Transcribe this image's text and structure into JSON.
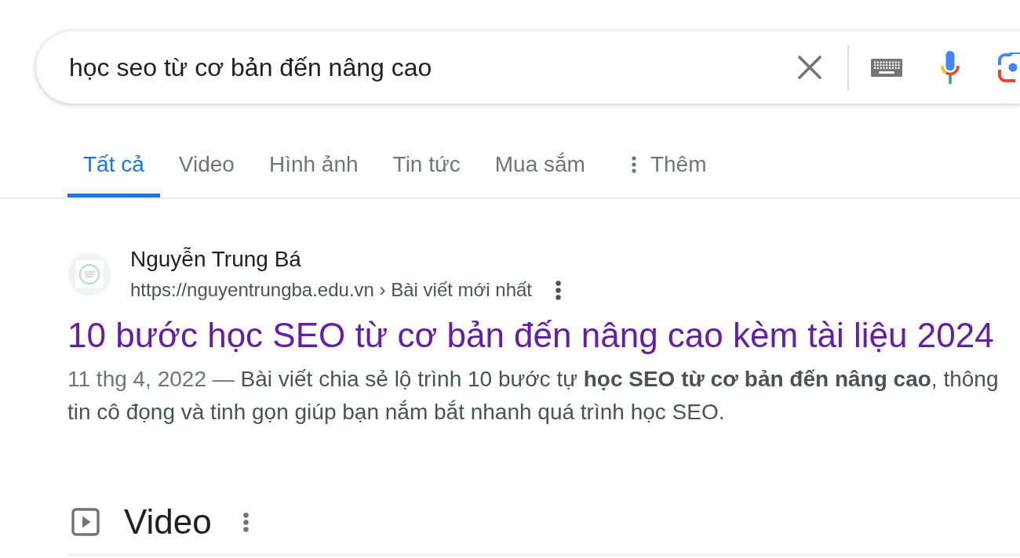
{
  "search": {
    "query": "học seo từ cơ bản đến nâng cao"
  },
  "tabs": [
    {
      "label": "Tất cả",
      "kind": "tab",
      "selected": true
    },
    {
      "label": "Video",
      "kind": "tab",
      "selected": false
    },
    {
      "label": "Hình ảnh",
      "kind": "tab",
      "selected": false
    },
    {
      "label": "Tin tức",
      "kind": "tab",
      "selected": false
    },
    {
      "label": "Mua sắm",
      "kind": "tab",
      "selected": false
    },
    {
      "label": "Thêm",
      "kind": "more",
      "selected": false
    }
  ],
  "results": [
    {
      "site_name": "Nguyễn Trung Bá",
      "url": "https://nguyentrungba.edu.vn › Bài viết mới nhất",
      "title": "10 bước học SEO từ cơ bản đến nâng cao kèm tài liệu 2024",
      "visited": true,
      "date": "11 thg 4, 2022 —",
      "snippet": "Bài viết chia sẻ lộ trình 10 bước tự **học SEO từ cơ bản đến nâng cao**, thông tin cô đọng và tinh gọn giúp bạn nắm bắt nhanh quá trình học SEO."
    }
  ],
  "sections": [
    {
      "heading": "Video"
    }
  ]
}
